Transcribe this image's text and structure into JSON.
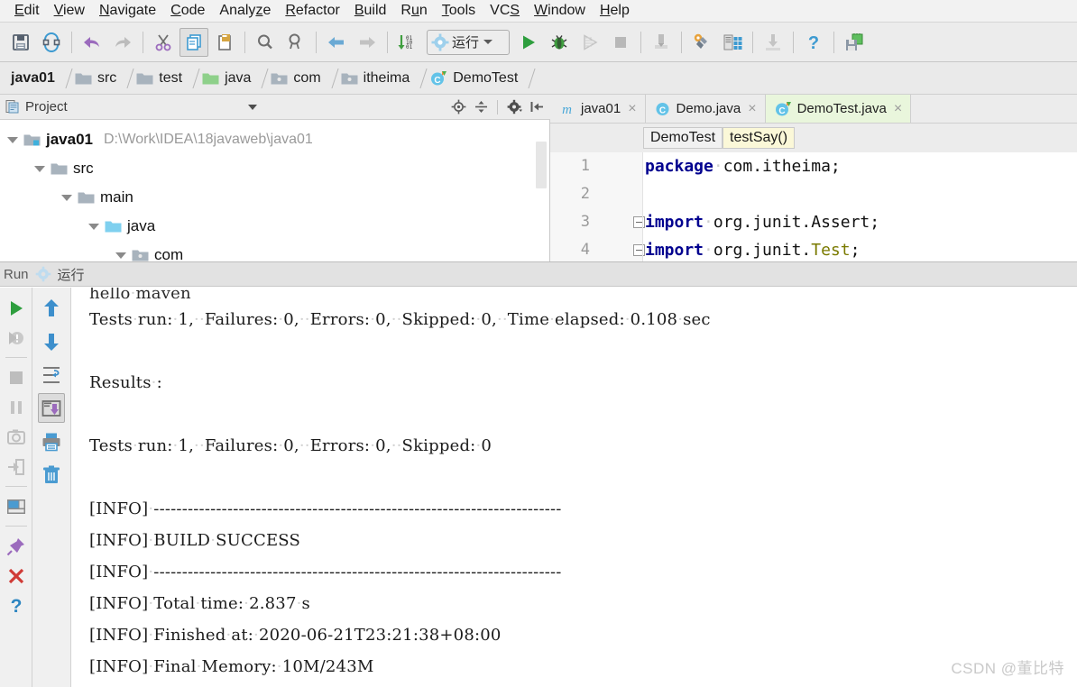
{
  "menu": {
    "items": [
      {
        "label": "Edit",
        "mnemonic": "E"
      },
      {
        "label": "View",
        "mnemonic": "V"
      },
      {
        "label": "Navigate",
        "mnemonic": "N"
      },
      {
        "label": "Code",
        "mnemonic": "C"
      },
      {
        "label": "Analyze",
        "mnemonic": "z"
      },
      {
        "label": "Refactor",
        "mnemonic": "R"
      },
      {
        "label": "Build",
        "mnemonic": "B"
      },
      {
        "label": "Run",
        "mnemonic": "u"
      },
      {
        "label": "Tools",
        "mnemonic": "T"
      },
      {
        "label": "VCS",
        "mnemonic": "S"
      },
      {
        "label": "Window",
        "mnemonic": "W"
      },
      {
        "label": "Help",
        "mnemonic": "H"
      }
    ]
  },
  "toolbar": {
    "icons": [
      "save-all-icon",
      "sync-icon",
      "undo-icon",
      "redo-icon",
      "cut-icon",
      "copy-icon",
      "paste-icon",
      "find-icon",
      "replace-icon",
      "back-icon",
      "forward-icon",
      "compile-icon"
    ],
    "run_config": {
      "label": "运行",
      "icon": "gear-icon"
    },
    "run_label": "Run",
    "debug_label": "Debug",
    "coverage_label": "Run with Coverage",
    "stop_label": "Stop",
    "right_icons": [
      "profiler-icon",
      "settings-wrench-icon",
      "project-structure-icon",
      "update-project-icon",
      "help-icon",
      "save-to-device-icon"
    ]
  },
  "breadcrumb": {
    "items": [
      {
        "label": "java01",
        "icon": "module-icon"
      },
      {
        "label": "src",
        "icon": "folder-icon"
      },
      {
        "label": "test",
        "icon": "folder-icon"
      },
      {
        "label": "java",
        "icon": "source-folder-icon"
      },
      {
        "label": "com",
        "icon": "package-icon"
      },
      {
        "label": "itheima",
        "icon": "package-icon"
      },
      {
        "label": "DemoTest",
        "icon": "test-class-icon"
      }
    ]
  },
  "project_panel": {
    "title": "Project",
    "icon": "project-icon",
    "header_icons": [
      "locate-icon",
      "collapse-all-icon",
      "gear-icon",
      "hide-icon"
    ],
    "tree": [
      {
        "label": "java01",
        "path": "D:\\Work\\IDEA\\18javaweb\\java01",
        "depth": 0,
        "icon": "module-icon",
        "expanded": true
      },
      {
        "label": "src",
        "path": "",
        "depth": 1,
        "icon": "folder-icon",
        "expanded": true
      },
      {
        "label": "main",
        "path": "",
        "depth": 2,
        "icon": "folder-icon",
        "expanded": true
      },
      {
        "label": "java",
        "path": "",
        "depth": 3,
        "icon": "source-folder-icon",
        "expanded": true
      },
      {
        "label": "com",
        "path": "",
        "depth": 4,
        "icon": "package-icon",
        "expanded": true
      }
    ]
  },
  "editor": {
    "tabs": [
      {
        "label": "java01",
        "icon": "maven-icon",
        "active": false
      },
      {
        "label": "Demo.java",
        "icon": "class-icon",
        "active": false
      },
      {
        "label": "DemoTest.java",
        "icon": "test-class-icon",
        "active": true
      }
    ],
    "close_glyph": "×",
    "code_breadcrumbs": [
      {
        "label": "DemoTest",
        "highlighted": false
      },
      {
        "label": "testSay()",
        "highlighted": true
      }
    ],
    "lines": [
      {
        "number": "1",
        "fold": false,
        "tokens": [
          {
            "t": "package",
            "c": "kw"
          },
          {
            "t": "·",
            "c": "dot"
          },
          {
            "t": "com.itheima;",
            "c": "pl"
          }
        ]
      },
      {
        "number": "2",
        "fold": false,
        "tokens": []
      },
      {
        "number": "3",
        "fold": true,
        "tokens": [
          {
            "t": "import",
            "c": "kw"
          },
          {
            "t": "·",
            "c": "dot"
          },
          {
            "t": "org.junit.Assert;",
            "c": "pl"
          }
        ]
      },
      {
        "number": "4",
        "fold": true,
        "tokens": [
          {
            "t": "import",
            "c": "kw"
          },
          {
            "t": "·",
            "c": "dot"
          },
          {
            "t": "org.junit.",
            "c": "pl"
          },
          {
            "t": "Test",
            "c": "cls"
          },
          {
            "t": ";",
            "c": "pl"
          }
        ]
      }
    ]
  },
  "run_window": {
    "title": "Run",
    "config_name": "运行",
    "config_icon": "gear-icon",
    "left_toolbar": [
      {
        "name": "rerun-icon",
        "enabled": true
      },
      {
        "name": "rerun-failed-tests-icon",
        "enabled": false
      },
      {
        "name": "stop-icon",
        "enabled": false
      },
      {
        "name": "pause-icon",
        "enabled": false
      },
      {
        "name": "dump-threads-icon",
        "enabled": false
      },
      {
        "name": "exit-icon",
        "enabled": false
      },
      {
        "name": "layout-settings-icon",
        "enabled": true
      },
      {
        "name": "pin-tab-icon",
        "enabled": true
      },
      {
        "name": "close-icon",
        "enabled": true
      },
      {
        "name": "help-icon",
        "enabled": true
      }
    ],
    "right_toolbar": [
      {
        "name": "up-arrow-icon",
        "pressed": false
      },
      {
        "name": "down-arrow-icon",
        "pressed": false
      },
      {
        "name": "soft-wrap-icon",
        "pressed": false
      },
      {
        "name": "scroll-to-end-icon",
        "pressed": true
      },
      {
        "name": "print-icon",
        "pressed": false
      },
      {
        "name": "clear-all-icon",
        "pressed": false
      }
    ],
    "console": [
      {
        "text": "hello·maven",
        "clipped": true
      },
      {
        "text": "Tests·run:·1,··Failures:·0,··Errors:·0,··Skipped:·0,··Time·elapsed:·0.108·sec"
      },
      {
        "text": ""
      },
      {
        "text": "Results·:"
      },
      {
        "text": ""
      },
      {
        "text": "Tests·run:·1,··Failures:·0,··Errors:·0,··Skipped:·0"
      },
      {
        "text": ""
      },
      {
        "text": "[INFO]·------------------------------------------------------------------------"
      },
      {
        "text": "[INFO]·BUILD·SUCCESS"
      },
      {
        "text": "[INFO]·------------------------------------------------------------------------"
      },
      {
        "text": "[INFO]·Total·time:·2.837·s"
      },
      {
        "text": "[INFO]·Finished·at:·2020-06-21T23:21:38+08:00"
      },
      {
        "text": "[INFO]·Final·Memory:·10M/243M"
      }
    ]
  },
  "watermark": "CSDN @董比特",
  "colors": {
    "accent_green": "#4aa02c",
    "keyword_blue": "#00008f",
    "active_tab_green": "#e9f6dc",
    "breadcrumb_highlight": "#fbf8d8",
    "toolbar_bg": "#ececec",
    "panel_bg": "#f0f0f0"
  }
}
